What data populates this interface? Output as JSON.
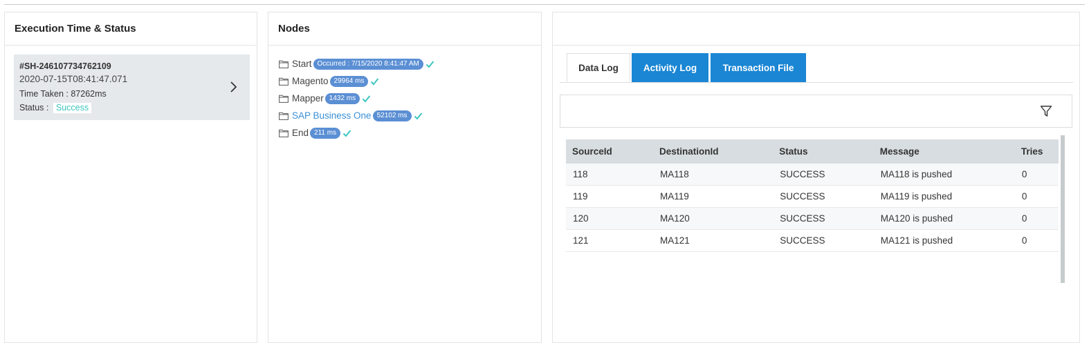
{
  "panels": {
    "execution": {
      "title": "Execution Time & Status",
      "card": {
        "id": "#SH-246107734762109",
        "timestamp": "2020-07-15T08:41:47.071",
        "time_taken": "Time Taken : 87262ms",
        "status_label": "Status :",
        "status_value": "Success"
      }
    },
    "nodes": {
      "title": "Nodes",
      "items": [
        {
          "name": "Start",
          "badge": "Occurred : 7/15/2020 8:41:47 AM",
          "active": false
        },
        {
          "name": "Magento",
          "badge": "29964 ms",
          "active": false
        },
        {
          "name": "Mapper",
          "badge": "1432 ms",
          "active": false
        },
        {
          "name": "SAP Business One",
          "badge": "52102 ms",
          "active": true
        },
        {
          "name": "End",
          "badge": "211 ms",
          "active": false
        }
      ]
    },
    "log": {
      "title": "",
      "tabs": [
        "Data Log",
        "Activity Log",
        "Transaction File"
      ],
      "table": {
        "headers": [
          "SourceId",
          "DestinationId",
          "Status",
          "Message",
          "Tries"
        ],
        "rows": [
          [
            "118",
            "MA118",
            "SUCCESS",
            "MA118 is pushed",
            "0"
          ],
          [
            "119",
            "MA119",
            "SUCCESS",
            "MA119 is pushed",
            "0"
          ],
          [
            "120",
            "MA120",
            "SUCCESS",
            "MA120 is pushed",
            "0"
          ],
          [
            "121",
            "MA121",
            "SUCCESS",
            "MA121 is pushed",
            "0"
          ]
        ]
      }
    }
  },
  "colors": {
    "accent_blue": "#1a86d4",
    "success_teal": "#3cc6c0",
    "pill_blue": "#5b8fd4",
    "active_link": "#3a8fd6"
  },
  "icons": {
    "folder": "folder-icon",
    "check": "check-icon",
    "chevron": "chevron-right-icon",
    "filter": "filter-icon"
  }
}
